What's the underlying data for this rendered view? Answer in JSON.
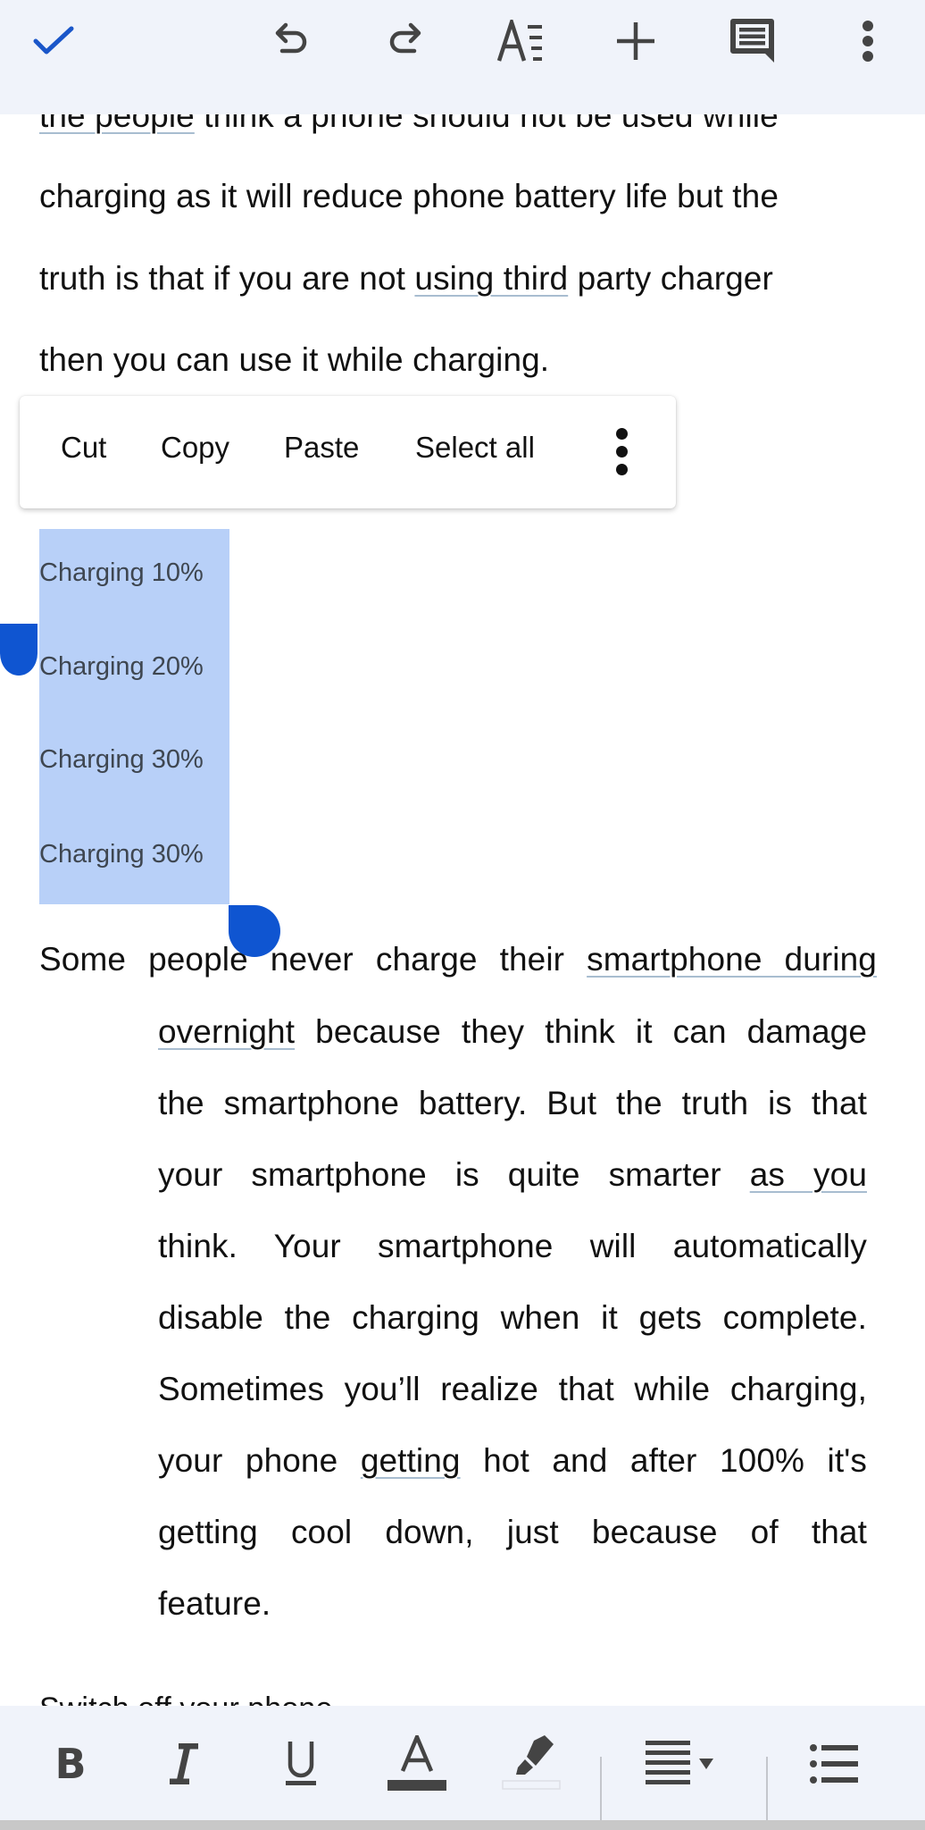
{
  "toolbar_top": {
    "done": "check-icon",
    "undo": "undo-icon",
    "redo": "redo-icon",
    "text_format": "text-format-icon",
    "insert": "plus-icon",
    "comment": "comment-icon",
    "more": "more-vert-icon",
    "accent_color": "#1a56c9"
  },
  "document": {
    "paragraph1_lines": [
      "the people think a phone should not be used while",
      "charging as it will reduce phone battery life but the",
      "truth is that if you are not using third party charger",
      "then you can use it while charging."
    ],
    "selected_list": [
      "Charging 10%",
      "Charging 20%",
      "Charging 30%",
      "Charging 30%"
    ],
    "paragraph2_first_line": "Some people never charge their smartphone during",
    "paragraph2_lines": [
      "overnight because they think it can damage",
      "the smartphone battery. But the truth is that",
      "your smartphone is quite smarter as you",
      "think.  Your smartphone will automatically",
      "disable the charging when it gets complete.",
      "Sometimes you’ll realize that while charging,",
      "your phone getting hot and after 100% it's",
      "getting cool down, just because of that",
      "feature."
    ],
    "next_heading_partial": "Switch off your phone",
    "selection_color": "#b8d0f8",
    "handle_color": "#0f55d1"
  },
  "context_menu": {
    "items": [
      "Cut",
      "Copy",
      "Paste",
      "Select all"
    ],
    "more": "more-vert-icon"
  },
  "toolbar_bottom": {
    "bold": "B",
    "italic": "I",
    "underline": "U",
    "text_color": "A",
    "highlight": "highlighter-icon",
    "align": "align-justify-icon",
    "list": "bulleted-list-icon"
  }
}
